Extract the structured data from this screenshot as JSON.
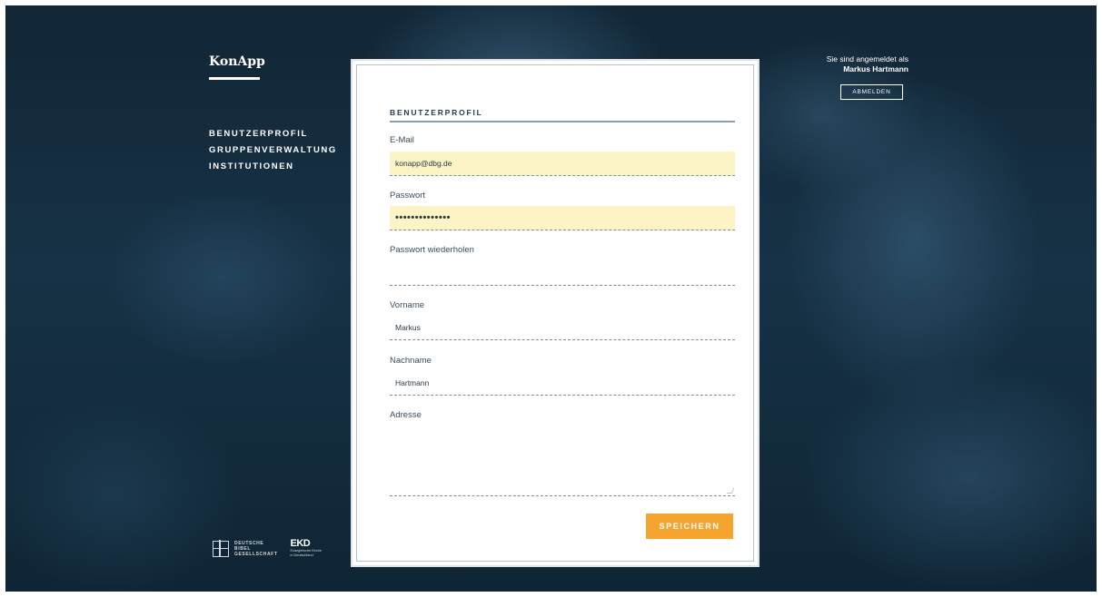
{
  "app": {
    "logo": "KonApp"
  },
  "nav": {
    "items": [
      {
        "label": "BENUTZERPROFIL"
      },
      {
        "label": "GRUPPENVERWALTUNG"
      },
      {
        "label": "INSTITUTIONEN"
      }
    ]
  },
  "user": {
    "signed_in_text": "Sie sind angemeldet als",
    "name": "Markus Hartmann",
    "logout_label": "ABMELDEN"
  },
  "form": {
    "title": "BENUTZERPROFIL",
    "email_label": "E-Mail",
    "email_value": "konapp@dbg.de",
    "password_label": "Passwort",
    "password_value": "••••••••••••••",
    "password_repeat_label": "Passwort wiederholen",
    "password_repeat_value": "",
    "firstname_label": "Vorname",
    "firstname_value": "Markus",
    "lastname_label": "Nachname",
    "lastname_value": "Hartmann",
    "address_label": "Adresse",
    "address_value": "",
    "save_label": "SPEICHERN"
  },
  "footer": {
    "dbg_lines": [
      "DEUTSCHE",
      "BIBEL",
      "GESELLSCHAFT"
    ],
    "ekd_title": "EKD",
    "ekd_sub_lines": [
      "Evangelische Kirche",
      "in Deutschland"
    ]
  },
  "colors": {
    "accent": "#f5a52f",
    "autofill": "#fdf4c6",
    "heading": "#1e3a4d",
    "background": "#173246"
  }
}
